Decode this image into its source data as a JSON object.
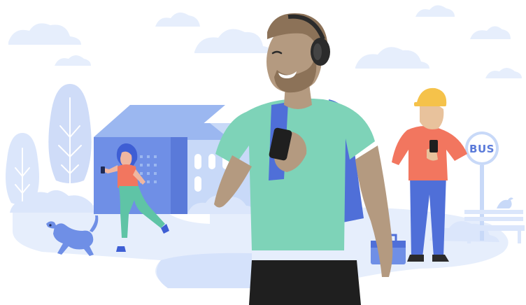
{
  "scene": {
    "sign_text": "BUS",
    "colors": {
      "sky_cloud": "#e6eefc",
      "light_blue": "#c8d9f8",
      "mid_blue": "#9bb7f0",
      "building_blue": "#6f8fe6",
      "dark_blue": "#4f6fd8",
      "shirt_green": "#7ed3b8",
      "skin_tan": "#b49a80",
      "headphones": "#2b2b2b",
      "pants_black": "#1f1f1f",
      "worker_orange": "#f2765f",
      "helmet_yellow": "#f5c24a",
      "woman_green": "#5fc4a6",
      "hair_blue": "#3e5ed4"
    }
  }
}
